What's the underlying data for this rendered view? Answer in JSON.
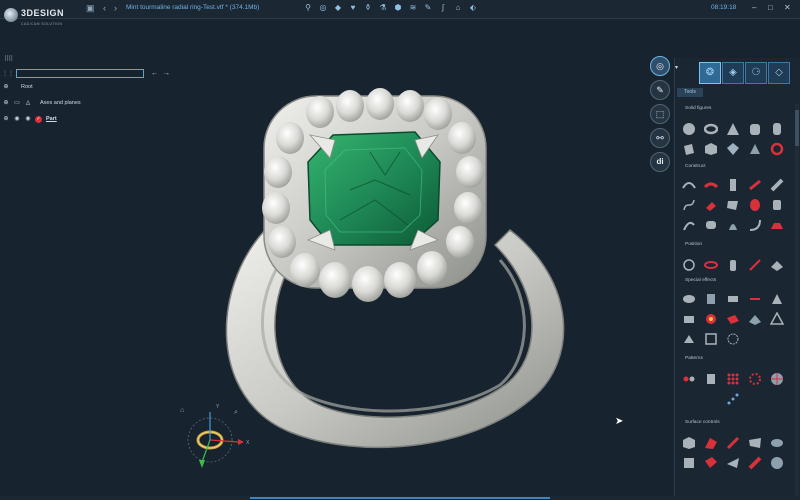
{
  "app": {
    "logo_text": "3DESIGN",
    "logo_subtext": "CAD/CAM SOLUTION",
    "document_title": "Mint tourmaline radial ring-Test.vtf * (374.1Mb)",
    "clock": "08:19:18"
  },
  "toolbar": {
    "nav_back": "‹",
    "nav_forward": "›",
    "center_tools": [
      "pendant-icon",
      "ring-icon",
      "gem-icon",
      "heart-icon",
      "bottle-icon",
      "vase-icon",
      "shield-icon",
      "wrap-icon",
      "sign-icon",
      "curve-icon",
      "gift-icon",
      "tag-icon"
    ]
  },
  "window_controls": {
    "minimize": "–",
    "maximize": "□",
    "close": "✕"
  },
  "left_panel": {
    "filter_placeholder": "",
    "filter_value": "",
    "collapse_label": "←",
    "expand_label": "→",
    "tree": [
      {
        "label": "Root"
      },
      {
        "label": "Axes and planes"
      },
      {
        "label": "Part"
      }
    ]
  },
  "right_strip": [
    "ring-icon",
    "pencil-icon",
    "cube-icon",
    "network-icon",
    "di-icon"
  ],
  "panel": {
    "tabs": [
      "cluster-icon",
      "gem-icon",
      "tree-icon",
      "diamond-settings-icon"
    ],
    "tools_tab_label": "Tools",
    "categories": [
      "Solid figures",
      "Construct",
      "Position",
      "Special effects",
      "Patterns",
      "Surface controls"
    ]
  },
  "colors": {
    "background": "#17232f",
    "accent": "#58a6d8",
    "gem": "#1f8a57",
    "metal": "#d9dad5",
    "tool_red": "#d8313a"
  }
}
